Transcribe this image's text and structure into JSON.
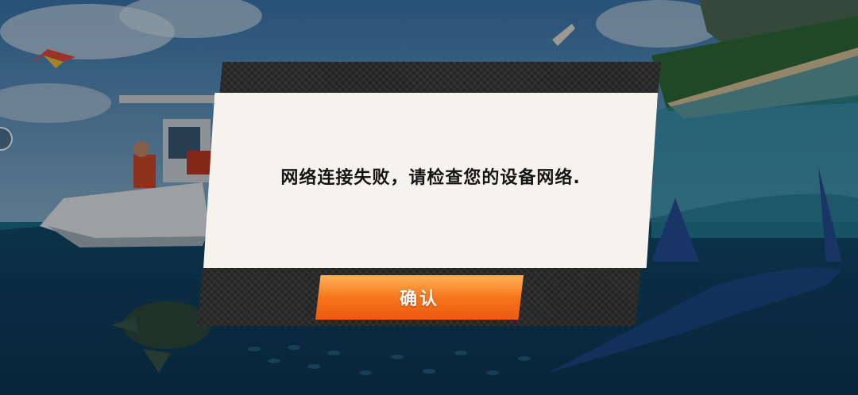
{
  "dialog": {
    "message": "网络连接失败，请检查您的设备网络.",
    "confirm_label": "确认"
  },
  "colors": {
    "panel": "#f5f3ec",
    "frame": "#2a2a2a",
    "button": "#f6731a",
    "text": "#151515"
  }
}
